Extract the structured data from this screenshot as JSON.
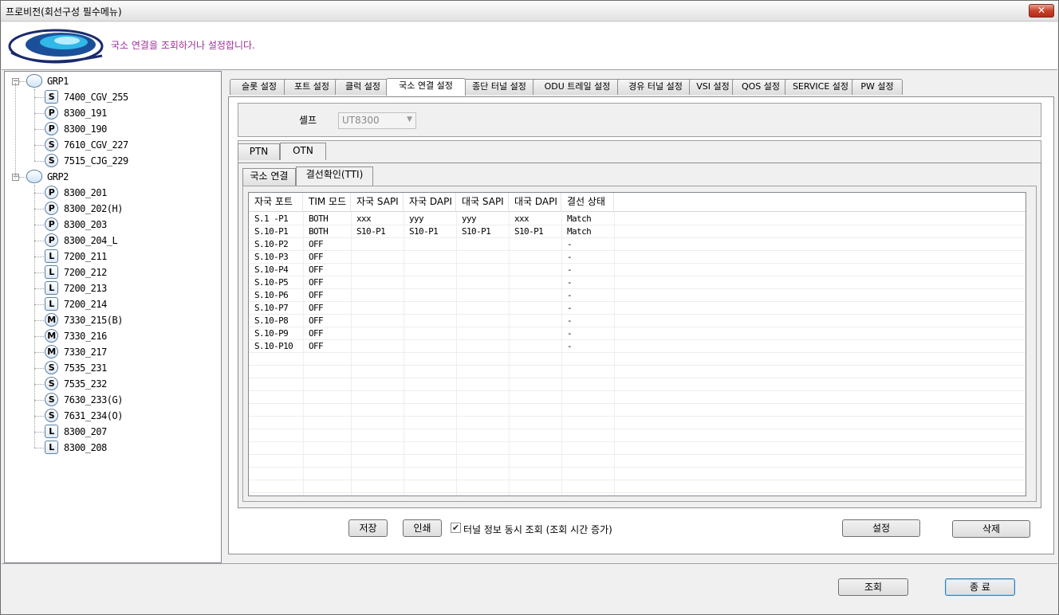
{
  "window": {
    "title": "프로비전(회선구성 필수메뉴)",
    "close_label": "✕"
  },
  "header": {
    "message": "국소 연결을 조회하거나 설정합니다."
  },
  "tree": {
    "groups": [
      {
        "label": "GRP1",
        "items": [
          {
            "icon": "S",
            "label": "7400_CGV_255"
          },
          {
            "icon": "P",
            "label": "8300_191"
          },
          {
            "icon": "P",
            "label": "8300_190"
          },
          {
            "icon": "S",
            "label": "7610_CGV_227"
          },
          {
            "icon": "S",
            "label": "7515_CJG_229"
          }
        ]
      },
      {
        "label": "GRP2",
        "items": [
          {
            "icon": "P",
            "label": "8300_201"
          },
          {
            "icon": "P",
            "label": "8300_202(H)"
          },
          {
            "icon": "P",
            "label": "8300_203"
          },
          {
            "icon": "P",
            "label": "8300_204_L"
          },
          {
            "icon": "L",
            "label": "7200_211"
          },
          {
            "icon": "L",
            "label": "7200_212"
          },
          {
            "icon": "L",
            "label": "7200_213"
          },
          {
            "icon": "L",
            "label": "7200_214"
          },
          {
            "icon": "M",
            "label": "7330_215(B)"
          },
          {
            "icon": "M",
            "label": "7330_216"
          },
          {
            "icon": "M",
            "label": "7330_217"
          },
          {
            "icon": "S",
            "label": "7535_231"
          },
          {
            "icon": "S",
            "label": "7535_232"
          },
          {
            "icon": "S",
            "label": "7630_233(G)"
          },
          {
            "icon": "S",
            "label": "7631_234(O)"
          },
          {
            "icon": "L",
            "label": "8300_207"
          },
          {
            "icon": "L",
            "label": "8300_208"
          }
        ]
      }
    ]
  },
  "tabs": [
    "슬롯 설정",
    "포트 설정",
    "클럭 설정",
    "국소 연결 설정",
    "종단 터널 설정",
    "ODU 트레일 설정",
    "경유 터널 설정",
    "VSI 설정",
    "QOS 설정",
    "SERVICE 설정",
    "PW 설정"
  ],
  "shelf": {
    "label": "셸프",
    "value": "UT8300"
  },
  "net_tabs": [
    "PTN",
    "OTN"
  ],
  "sub_tabs": [
    "국소 연결",
    "결선확인(TTI)"
  ],
  "table": {
    "headers": [
      "자국 포트",
      "TIM 모드",
      "자국 SAPI",
      "자국 DAPI",
      "대국 SAPI",
      "대국 DAPI",
      "결선 상태"
    ],
    "rows": [
      [
        "S.1 -P1",
        "BOTH",
        "xxx",
        "yyy",
        "yyy",
        "xxx",
        "Match"
      ],
      [
        "S.10-P1",
        "BOTH",
        "S10-P1",
        "S10-P1",
        "S10-P1",
        "S10-P1",
        "Match"
      ],
      [
        "S.10-P2",
        "OFF",
        "",
        "",
        "",
        "",
        "-"
      ],
      [
        "S.10-P3",
        "OFF",
        "",
        "",
        "",
        "",
        "-"
      ],
      [
        "S.10-P4",
        "OFF",
        "",
        "",
        "",
        "",
        "-"
      ],
      [
        "S.10-P5",
        "OFF",
        "",
        "",
        "",
        "",
        "-"
      ],
      [
        "S.10-P6",
        "OFF",
        "",
        "",
        "",
        "",
        "-"
      ],
      [
        "S.10-P7",
        "OFF",
        "",
        "",
        "",
        "",
        "-"
      ],
      [
        "S.10-P8",
        "OFF",
        "",
        "",
        "",
        "",
        "-"
      ],
      [
        "S.10-P9",
        "OFF",
        "",
        "",
        "",
        "",
        "-"
      ],
      [
        "S.10-P10",
        "OFF",
        "",
        "",
        "",
        "",
        "-"
      ]
    ]
  },
  "actions": {
    "save": "저장",
    "print": "인쇄",
    "tunnel_check": "터널 정보 동시 조회 (조회 시간 증가)",
    "set": "설정",
    "delete": "삭제"
  },
  "footer": {
    "query": "조회",
    "exit": "종 료"
  }
}
